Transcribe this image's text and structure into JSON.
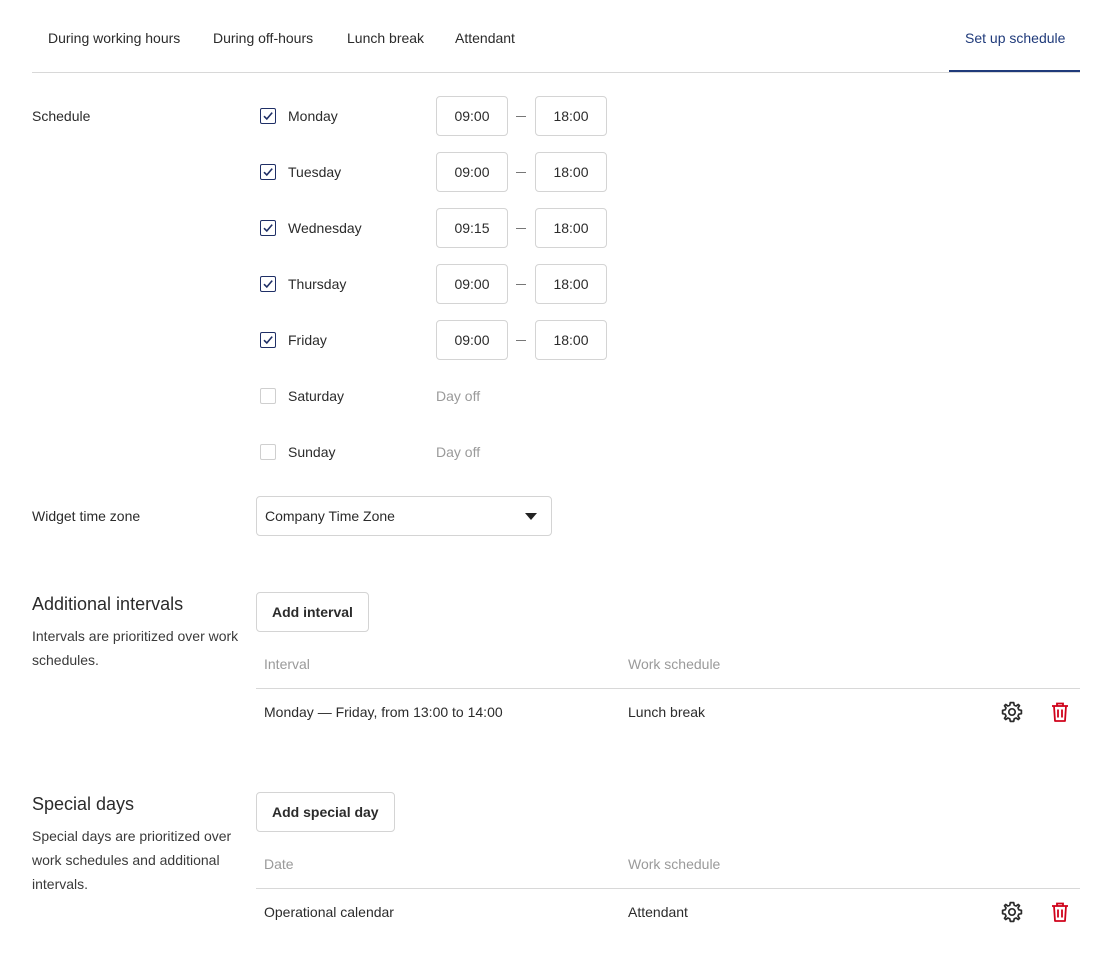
{
  "tabs": {
    "items": [
      "During working hours",
      "During off-hours",
      "Lunch break",
      "Attendant"
    ],
    "right": "Set up schedule"
  },
  "schedule": {
    "label": "Schedule",
    "days": [
      {
        "name": "Monday",
        "checked": true,
        "from": "09:00",
        "to": "18:00"
      },
      {
        "name": "Tuesday",
        "checked": true,
        "from": "09:00",
        "to": "18:00"
      },
      {
        "name": "Wednesday",
        "checked": true,
        "from": "09:15",
        "to": "18:00"
      },
      {
        "name": "Thursday",
        "checked": true,
        "from": "09:00",
        "to": "18:00"
      },
      {
        "name": "Friday",
        "checked": true,
        "from": "09:00",
        "to": "18:00"
      },
      {
        "name": "Saturday",
        "checked": false,
        "status": "Day off"
      },
      {
        "name": "Sunday",
        "checked": false,
        "status": "Day off"
      }
    ]
  },
  "timezone": {
    "label": "Widget time zone",
    "value": "Company Time Zone"
  },
  "intervals": {
    "title": "Additional intervals",
    "description": "Intervals are prioritized over work schedules.",
    "add_button": "Add interval",
    "columns": [
      "Interval",
      "Work schedule"
    ],
    "rows": [
      {
        "interval": "Monday — Friday, from 13:00 to 14:00",
        "schedule": "Lunch break"
      }
    ]
  },
  "special_days": {
    "title": "Special days",
    "description": "Special days are prioritized over work schedules and additional intervals.",
    "add_button": "Add special day",
    "columns": [
      "Date",
      "Work schedule"
    ],
    "rows": [
      {
        "date": "Operational calendar",
        "schedule": "Attendant"
      }
    ]
  },
  "icons": {
    "settings": "gear-icon",
    "delete": "trash-icon"
  },
  "colors": {
    "accent": "#1f3a7a",
    "checkbox": "#1f2f66",
    "delete": "#d0021b",
    "muted": "#9a9a9a"
  }
}
